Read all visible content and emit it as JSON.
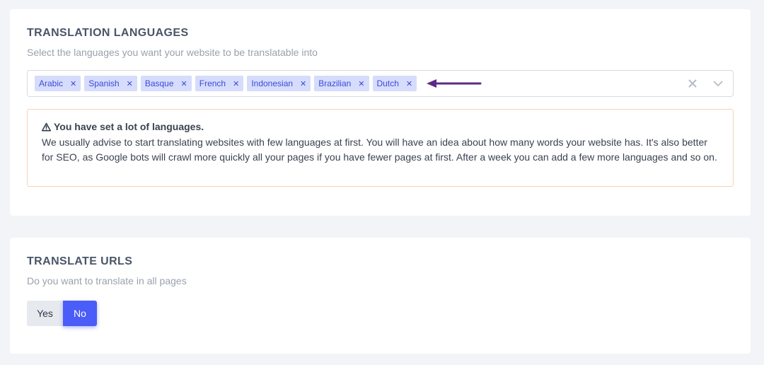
{
  "translation_languages": {
    "title": "TRANSLATION LANGUAGES",
    "description": "Select the languages you want your website to be translatable into",
    "selected": [
      {
        "label": "Arabic"
      },
      {
        "label": "Spanish"
      },
      {
        "label": "Basque"
      },
      {
        "label": "French"
      },
      {
        "label": "Indonesian"
      },
      {
        "label": "Brazilian"
      },
      {
        "label": "Dutch"
      }
    ],
    "tag_remove_glyph": "✕",
    "clear_icon": "close-icon",
    "dropdown_icon": "chevron-down-icon",
    "annotation_arrow_color": "#5b2a86",
    "warning": {
      "icon": "warning-icon",
      "title": "You have set a lot of languages.",
      "body": "We usually advise to start translating websites with few languages at first. You will have an idea about how many words your website has. It's also better for SEO, as Google bots will crawl more quickly all your pages if you have fewer pages at first. After a week you can add a few more languages and so on."
    }
  },
  "translate_urls": {
    "title": "TRANSLATE URLS",
    "description": "Do you want to translate in all pages",
    "options": {
      "yes": "Yes",
      "no": "No"
    },
    "selected": "No"
  },
  "colors": {
    "accent": "#4a5df8",
    "tag_bg": "#d6dcfb",
    "tag_text": "#3b4bd8",
    "warning_border": "#f6d3b7",
    "page_bg": "#f3f4f8"
  }
}
